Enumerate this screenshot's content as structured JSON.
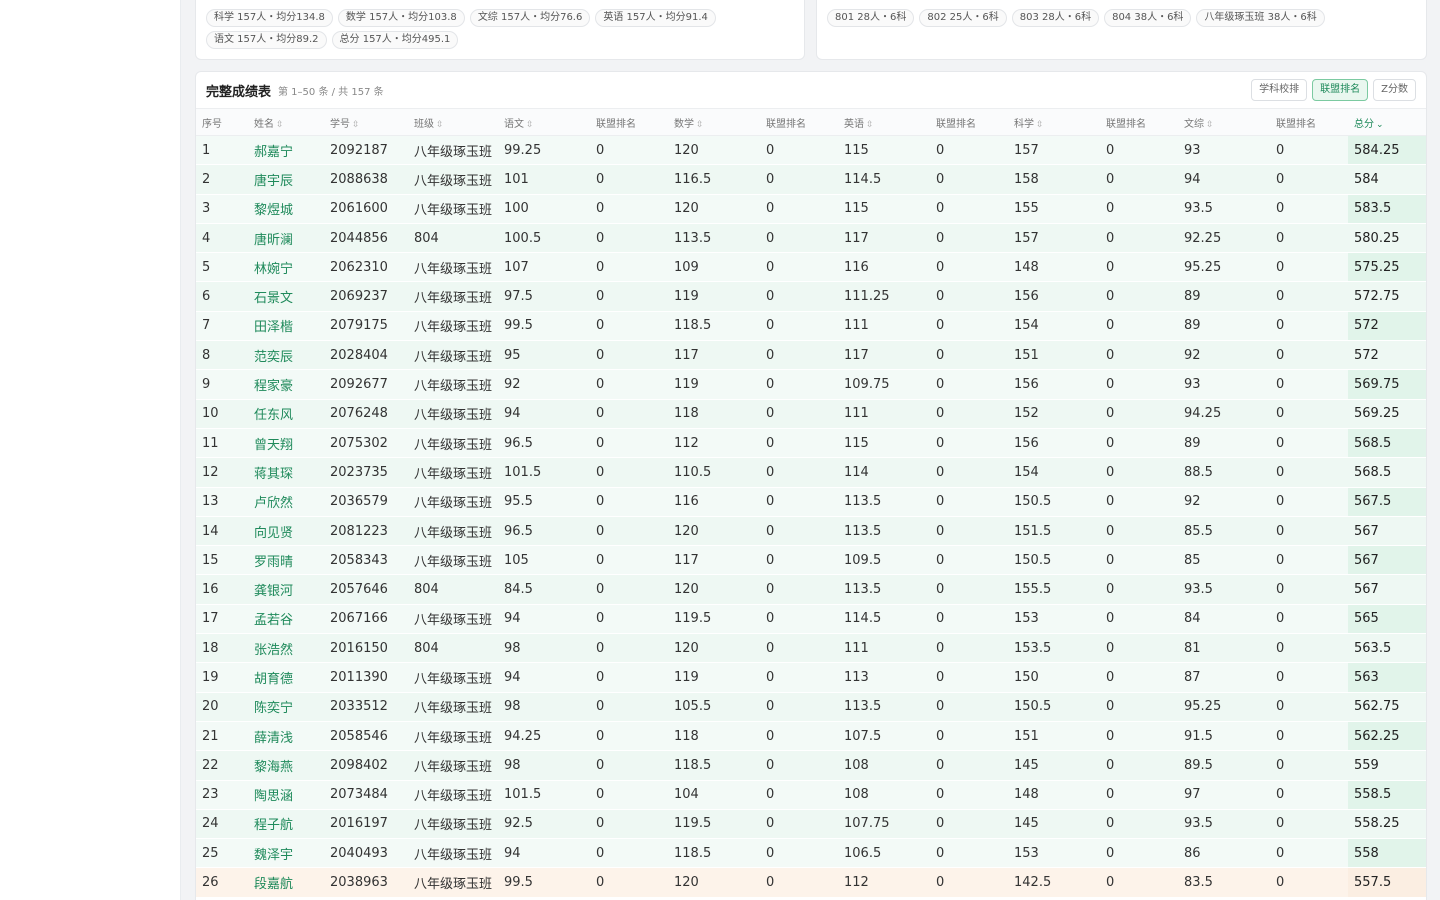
{
  "subject_stats": [
    "科学 157人・均分134.8",
    "数学 157人・均分103.8",
    "文综 157人・均分76.6",
    "英语 157人・均分91.4",
    "语文 157人・均分89.2",
    "总分 157人・均分495.1"
  ],
  "class_stats": [
    "801 28人・6科",
    "802 25人・6科",
    "803 28人・6科",
    "804 38人・6科",
    "八年级琢玉班 38人・6科"
  ],
  "table": {
    "title": "完整成绩表",
    "subtitle": "第 1–50 条 / 共 157 条",
    "tools": [
      "学科校排",
      "联盟排名",
      "Z分数"
    ],
    "active_tool": "联盟排名",
    "sort_up_down": "⇳",
    "sort_desc": "⌄",
    "columns": [
      "序号",
      "姓名",
      "学号",
      "班级",
      "语文",
      "联盟排名",
      "数学",
      "联盟排名",
      "英语",
      "联盟排名",
      "科学",
      "联盟排名",
      "文综",
      "联盟排名",
      "总分"
    ],
    "rows": [
      [
        "1",
        "郝嘉宁",
        "2092187",
        "八年级琢玉班",
        "99.25",
        "0",
        "120",
        "0",
        "115",
        "0",
        "157",
        "0",
        "93",
        "0",
        "584.25"
      ],
      [
        "2",
        "唐宇辰",
        "2088638",
        "八年级琢玉班",
        "101",
        "0",
        "116.5",
        "0",
        "114.5",
        "0",
        "158",
        "0",
        "94",
        "0",
        "584"
      ],
      [
        "3",
        "黎煜城",
        "2061600",
        "八年级琢玉班",
        "100",
        "0",
        "120",
        "0",
        "115",
        "0",
        "155",
        "0",
        "93.5",
        "0",
        "583.5"
      ],
      [
        "4",
        "唐昕澜",
        "2044856",
        "804",
        "100.5",
        "0",
        "113.5",
        "0",
        "117",
        "0",
        "157",
        "0",
        "92.25",
        "0",
        "580.25"
      ],
      [
        "5",
        "林婉宁",
        "2062310",
        "八年级琢玉班",
        "107",
        "0",
        "109",
        "0",
        "116",
        "0",
        "148",
        "0",
        "95.25",
        "0",
        "575.25"
      ],
      [
        "6",
        "石景文",
        "2069237",
        "八年级琢玉班",
        "97.5",
        "0",
        "119",
        "0",
        "111.25",
        "0",
        "156",
        "0",
        "89",
        "0",
        "572.75"
      ],
      [
        "7",
        "田泽楷",
        "2079175",
        "八年级琢玉班",
        "99.5",
        "0",
        "118.5",
        "0",
        "111",
        "0",
        "154",
        "0",
        "89",
        "0",
        "572"
      ],
      [
        "8",
        "范奕辰",
        "2028404",
        "八年级琢玉班",
        "95",
        "0",
        "117",
        "0",
        "117",
        "0",
        "151",
        "0",
        "92",
        "0",
        "572"
      ],
      [
        "9",
        "程家豪",
        "2092677",
        "八年级琢玉班",
        "92",
        "0",
        "119",
        "0",
        "109.75",
        "0",
        "156",
        "0",
        "93",
        "0",
        "569.75"
      ],
      [
        "10",
        "任东风",
        "2076248",
        "八年级琢玉班",
        "94",
        "0",
        "118",
        "0",
        "111",
        "0",
        "152",
        "0",
        "94.25",
        "0",
        "569.25"
      ],
      [
        "11",
        "曾天翔",
        "2075302",
        "八年级琢玉班",
        "96.5",
        "0",
        "112",
        "0",
        "115",
        "0",
        "156",
        "0",
        "89",
        "0",
        "568.5"
      ],
      [
        "12",
        "蒋其琛",
        "2023735",
        "八年级琢玉班",
        "101.5",
        "0",
        "110.5",
        "0",
        "114",
        "0",
        "154",
        "0",
        "88.5",
        "0",
        "568.5"
      ],
      [
        "13",
        "卢欣然",
        "2036579",
        "八年级琢玉班",
        "95.5",
        "0",
        "116",
        "0",
        "113.5",
        "0",
        "150.5",
        "0",
        "92",
        "0",
        "567.5"
      ],
      [
        "14",
        "向见贤",
        "2081223",
        "八年级琢玉班",
        "96.5",
        "0",
        "120",
        "0",
        "113.5",
        "0",
        "151.5",
        "0",
        "85.5",
        "0",
        "567"
      ],
      [
        "15",
        "罗雨晴",
        "2058343",
        "八年级琢玉班",
        "105",
        "0",
        "117",
        "0",
        "109.5",
        "0",
        "150.5",
        "0",
        "85",
        "0",
        "567"
      ],
      [
        "16",
        "龚银河",
        "2057646",
        "804",
        "84.5",
        "0",
        "120",
        "0",
        "113.5",
        "0",
        "155.5",
        "0",
        "93.5",
        "0",
        "567"
      ],
      [
        "17",
        "孟若谷",
        "2067166",
        "八年级琢玉班",
        "94",
        "0",
        "119.5",
        "0",
        "114.5",
        "0",
        "153",
        "0",
        "84",
        "0",
        "565"
      ],
      [
        "18",
        "张浩然",
        "2016150",
        "804",
        "98",
        "0",
        "120",
        "0",
        "111",
        "0",
        "153.5",
        "0",
        "81",
        "0",
        "563.5"
      ],
      [
        "19",
        "胡育德",
        "2011390",
        "八年级琢玉班",
        "94",
        "0",
        "119",
        "0",
        "113",
        "0",
        "150",
        "0",
        "87",
        "0",
        "563"
      ],
      [
        "20",
        "陈奕宁",
        "2033512",
        "八年级琢玉班",
        "98",
        "0",
        "105.5",
        "0",
        "113.5",
        "0",
        "150.5",
        "0",
        "95.25",
        "0",
        "562.75"
      ],
      [
        "21",
        "薛清浅",
        "2058546",
        "八年级琢玉班",
        "94.25",
        "0",
        "118",
        "0",
        "107.5",
        "0",
        "151",
        "0",
        "91.5",
        "0",
        "562.25"
      ],
      [
        "22",
        "黎海燕",
        "2098402",
        "八年级琢玉班",
        "98",
        "0",
        "118.5",
        "0",
        "108",
        "0",
        "145",
        "0",
        "89.5",
        "0",
        "559"
      ],
      [
        "23",
        "陶思涵",
        "2073484",
        "八年级琢玉班",
        "101.5",
        "0",
        "104",
        "0",
        "108",
        "0",
        "148",
        "0",
        "97",
        "0",
        "558.5"
      ],
      [
        "24",
        "程子航",
        "2016197",
        "八年级琢玉班",
        "92.5",
        "0",
        "119.5",
        "0",
        "107.75",
        "0",
        "145",
        "0",
        "93.5",
        "0",
        "558.25"
      ],
      [
        "25",
        "魏泽宇",
        "2040493",
        "八年级琢玉班",
        "94",
        "0",
        "118.5",
        "0",
        "106.5",
        "0",
        "153",
        "0",
        "86",
        "0",
        "558"
      ],
      [
        "26",
        "段嘉航",
        "2038963",
        "八年级琢玉班",
        "99.5",
        "0",
        "120",
        "0",
        "112",
        "0",
        "142.5",
        "0",
        "83.5",
        "0",
        "557.5"
      ]
    ],
    "highlight_row": 26
  },
  "colors": {
    "accent": "#1f8a5b",
    "row_bg": "#f3faf7",
    "total_bg": "#e1f4ea",
    "highlight_bg": "#fdf3ea"
  }
}
